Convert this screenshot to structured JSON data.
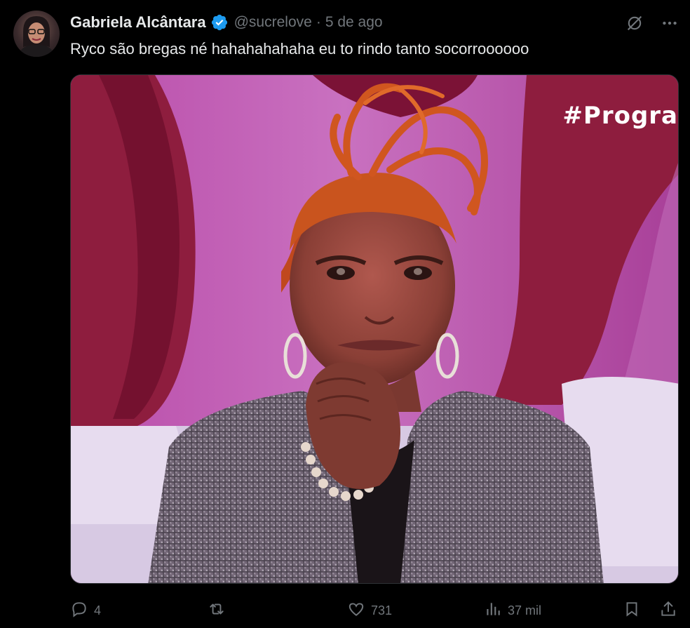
{
  "tweet": {
    "author_name": "Gabriela Alcântara",
    "handle": "@sucrelove",
    "separator": "·",
    "date": "5 de ago",
    "text": "Ryco são bregas né hahahahahaha eu to rindo tanto socorroooooo",
    "media_overlay_text": "#Progra"
  },
  "actions": {
    "replies": "4",
    "retweets": "",
    "likes": "731",
    "views": "37 mil"
  },
  "icons": {
    "verified": "verified-badge-icon",
    "grok": "grok-icon",
    "more": "more-icon",
    "reply": "reply-icon",
    "retweet": "retweet-icon",
    "like": "heart-icon",
    "views": "views-bar-chart-icon",
    "bookmark": "bookmark-icon",
    "share": "share-icon"
  },
  "colors": {
    "background": "#000000",
    "text_primary": "#e7e9ea",
    "text_secondary": "#71767b",
    "verified_blue": "#1d9bf0"
  }
}
